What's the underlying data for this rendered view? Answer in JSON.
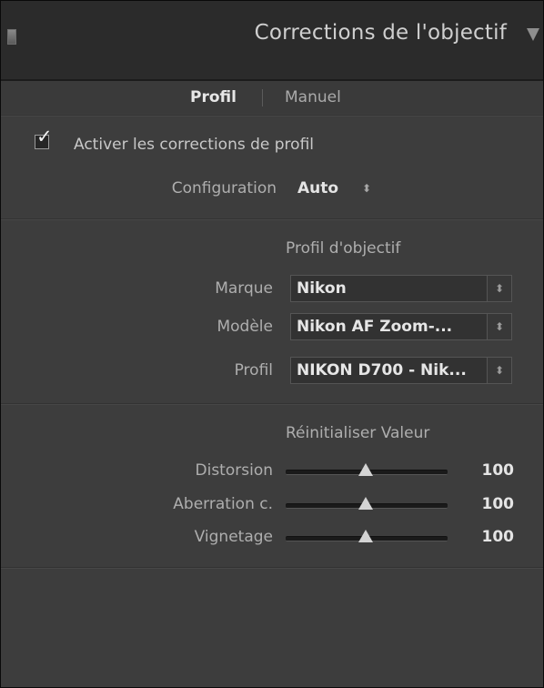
{
  "header": {
    "title": "Corrections de l'objectif",
    "collapse_icon": "panel-switch-icon",
    "disclosure_icon": "triangle-down-icon"
  },
  "tabs": [
    {
      "label": "Profil",
      "active": true
    },
    {
      "label": "Manuel",
      "active": false
    }
  ],
  "profile_corrections": {
    "checkbox_label": "Activer les corrections de profil",
    "checked": true,
    "setup_label": "Configuration",
    "setup_value": "Auto",
    "setup_icon": "updown-arrows-icon"
  },
  "lens_profile": {
    "heading": "Profil d'objectif",
    "make_label": "Marque",
    "make_value": "Nikon",
    "model_label": "Modèle",
    "model_value": "Nikon AF Zoom-...",
    "profile_label": "Profil",
    "profile_value": "NIKON D700 - Nik...",
    "select_icon": "updown-arrows-icon"
  },
  "amount": {
    "heading": "Réinitialiser Valeur",
    "distortion_label": "Distorsion",
    "distortion_value": "100",
    "ca_label": "Aberration c.",
    "ca_value": "100",
    "vignetting_label": "Vignetage",
    "vignetting_value": "100"
  },
  "colors": {
    "panel_bg": "#3d3d3d",
    "header_bg": "#2b2b2b",
    "text_bright": "#e4e4e4",
    "text_dim": "#aeaeae"
  }
}
